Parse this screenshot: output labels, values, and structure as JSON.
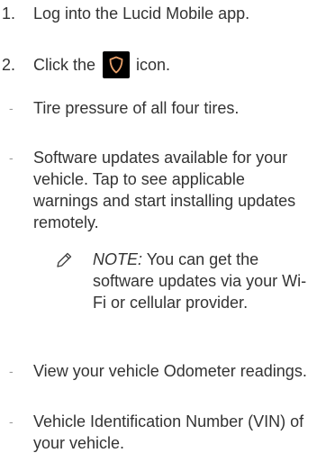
{
  "steps": [
    {
      "number": "1.",
      "text": "Log into the Lucid Mobile app."
    },
    {
      "number": "2.",
      "text_before": "Click the",
      "text_after": "icon."
    }
  ],
  "bullets": [
    {
      "text": "Tire pressure of all four tires."
    },
    {
      "text": "Software updates available for your vehicle. Tap to see applicable warnings and start installing updates remotely."
    },
    {
      "text": "View your vehicle Odometer readings."
    },
    {
      "text": "Vehicle Identification Number (VIN) of your vehicle."
    }
  ],
  "bullet_marker": "-",
  "note": {
    "label": "NOTE:",
    "text": "You can get the software updates via your Wi-Fi or cellular provider."
  },
  "icons": {
    "app_icon": "shield-icon",
    "note_icon": "pencil-icon"
  },
  "colors": {
    "text": "#333333",
    "icon_background": "#000000",
    "icon_accent": "#e8a06a"
  }
}
